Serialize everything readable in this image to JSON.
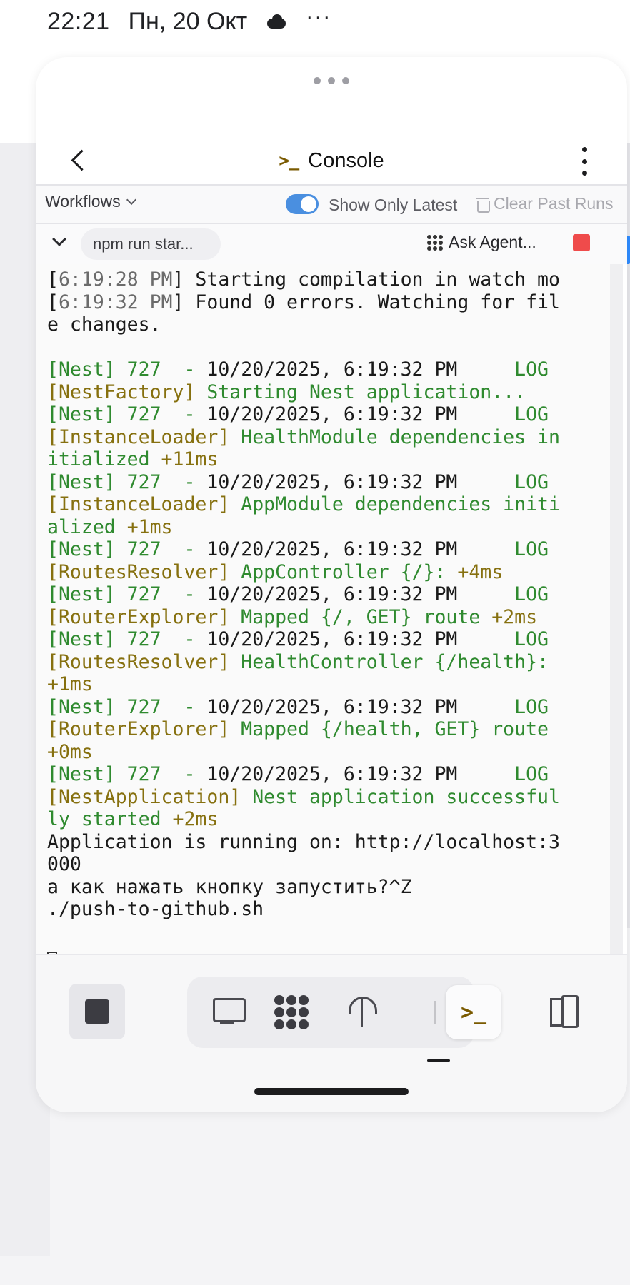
{
  "status_bar": {
    "time": "22:21",
    "date": "Пн, 20 Окт",
    "cloud_icon": "cloud-icon",
    "more": "···"
  },
  "topbar": {
    "title": "Console",
    "title_icon": "terminal-icon",
    "back_icon": "chevron-left-icon",
    "menu_icon": "kebab-menu-icon"
  },
  "workflows": {
    "dropdown_label": "Workflows",
    "toggle_label": "Show Only Latest",
    "toggle_on": true,
    "clear_label": "Clear Past Runs"
  },
  "run": {
    "command": "npm run star...",
    "ask_agent": "Ask Agent...",
    "stop_color": "#ef4b4b"
  },
  "colors": {
    "green": "#2f8a2f",
    "olive": "#86700f",
    "toggle_blue": "#4a8fe0"
  },
  "console": {
    "lines": [
      [
        [
          "[",
          "black"
        ],
        [
          "6:19:28 PM",
          "gray"
        ],
        [
          "] Starting compilation in watch mo",
          "black"
        ]
      ],
      [
        [
          "[",
          "black"
        ],
        [
          "6:19:32 PM",
          "gray"
        ],
        [
          "] Found 0 errors. Watching for fil",
          "black"
        ]
      ],
      [
        [
          "e changes.",
          "black"
        ]
      ],
      [
        [
          "",
          "black"
        ]
      ],
      [
        [
          "[Nest] 727  - ",
          "green"
        ],
        [
          "10/20/2025, 6:19:32 PM",
          "black"
        ],
        [
          "     LOG",
          "green"
        ]
      ],
      [
        [
          "[NestFactory] ",
          "olive"
        ],
        [
          "Starting Nest application...",
          "green"
        ]
      ],
      [
        [
          "[Nest] 727  - ",
          "green"
        ],
        [
          "10/20/2025, 6:19:32 PM",
          "black"
        ],
        [
          "     LOG",
          "green"
        ]
      ],
      [
        [
          "[InstanceLoader] ",
          "olive"
        ],
        [
          "HealthModule dependencies in",
          "green"
        ]
      ],
      [
        [
          "itialized ",
          "green"
        ],
        [
          "+11ms",
          "olive"
        ]
      ],
      [
        [
          "[Nest] 727  - ",
          "green"
        ],
        [
          "10/20/2025, 6:19:32 PM",
          "black"
        ],
        [
          "     LOG",
          "green"
        ]
      ],
      [
        [
          "[InstanceLoader] ",
          "olive"
        ],
        [
          "AppModule dependencies initi",
          "green"
        ]
      ],
      [
        [
          "alized ",
          "green"
        ],
        [
          "+1ms",
          "olive"
        ]
      ],
      [
        [
          "[Nest] 727  - ",
          "green"
        ],
        [
          "10/20/2025, 6:19:32 PM",
          "black"
        ],
        [
          "     LOG",
          "green"
        ]
      ],
      [
        [
          "[RoutesResolver] ",
          "olive"
        ],
        [
          "AppController {/}: ",
          "green"
        ],
        [
          "+4ms",
          "olive"
        ]
      ],
      [
        [
          "[Nest] 727  - ",
          "green"
        ],
        [
          "10/20/2025, 6:19:32 PM",
          "black"
        ],
        [
          "     LOG",
          "green"
        ]
      ],
      [
        [
          "[RouterExplorer] ",
          "olive"
        ],
        [
          "Mapped {/, GET} route ",
          "green"
        ],
        [
          "+2ms",
          "olive"
        ]
      ],
      [
        [
          "[Nest] 727  - ",
          "green"
        ],
        [
          "10/20/2025, 6:19:32 PM",
          "black"
        ],
        [
          "     LOG",
          "green"
        ]
      ],
      [
        [
          "[RoutesResolver] ",
          "olive"
        ],
        [
          "HealthController {/health}:",
          "green"
        ]
      ],
      [
        [
          "+1ms",
          "olive"
        ]
      ],
      [
        [
          "[Nest] 727  - ",
          "green"
        ],
        [
          "10/20/2025, 6:19:32 PM",
          "black"
        ],
        [
          "     LOG",
          "green"
        ]
      ],
      [
        [
          "[RouterExplorer] ",
          "olive"
        ],
        [
          "Mapped {/health, GET} route",
          "green"
        ]
      ],
      [
        [
          "+0ms",
          "olive"
        ]
      ],
      [
        [
          "[Nest] 727  - ",
          "green"
        ],
        [
          "10/20/2025, 6:19:32 PM",
          "black"
        ],
        [
          "     LOG",
          "green"
        ]
      ],
      [
        [
          "[NestApplication] ",
          "olive"
        ],
        [
          "Nest application successful",
          "green"
        ]
      ],
      [
        [
          "ly started ",
          "green"
        ],
        [
          "+2ms",
          "olive"
        ]
      ],
      [
        [
          "Application is running on: http://localhost:3",
          "black"
        ]
      ],
      [
        [
          "000",
          "black"
        ]
      ],
      [
        [
          "а как нажать кнопку запустить?^Z",
          "black"
        ]
      ],
      [
        [
          "./push-to-github.sh",
          "black"
        ]
      ],
      [
        [
          "",
          "black"
        ]
      ]
    ]
  },
  "bottom_bar": {
    "stop_icon": "stop-square-icon",
    "tools": [
      "monitor-icon",
      "agent-icon",
      "deploy-icon",
      "terminal-icon"
    ],
    "split_icon": "split-view-icon"
  }
}
